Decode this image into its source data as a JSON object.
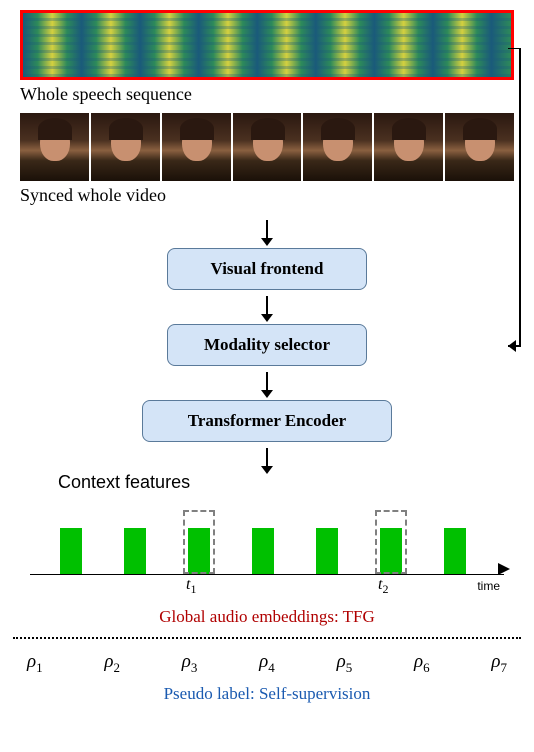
{
  "labels": {
    "speech_sequence": "Whole speech sequence",
    "synced_video": "Synced whole video",
    "context_features": "Context features",
    "time": "time",
    "tfg": "Global audio embeddings: TFG",
    "pseudo": "Pseudo label: Self-supervision"
  },
  "boxes": {
    "visual_frontend": "Visual frontend",
    "modality_selector": "Modality selector",
    "transformer_encoder": "Transformer Encoder"
  },
  "time_marks": {
    "t1": "t",
    "t1_sub": "1",
    "t2": "t",
    "t2_sub": "2"
  },
  "rhos": [
    {
      "sym": "ρ",
      "sub": "1"
    },
    {
      "sym": "ρ",
      "sub": "2"
    },
    {
      "sym": "ρ",
      "sub": "3"
    },
    {
      "sym": "ρ",
      "sub": "4"
    },
    {
      "sym": "ρ",
      "sub": "5"
    },
    {
      "sym": "ρ",
      "sub": "6"
    },
    {
      "sym": "ρ",
      "sub": "7"
    }
  ],
  "feature_positions": [
    40,
    104,
    168,
    232,
    296,
    360,
    424
  ],
  "dashed_positions": [
    163,
    355
  ],
  "t_positions": {
    "t1": 166,
    "t2": 358
  }
}
